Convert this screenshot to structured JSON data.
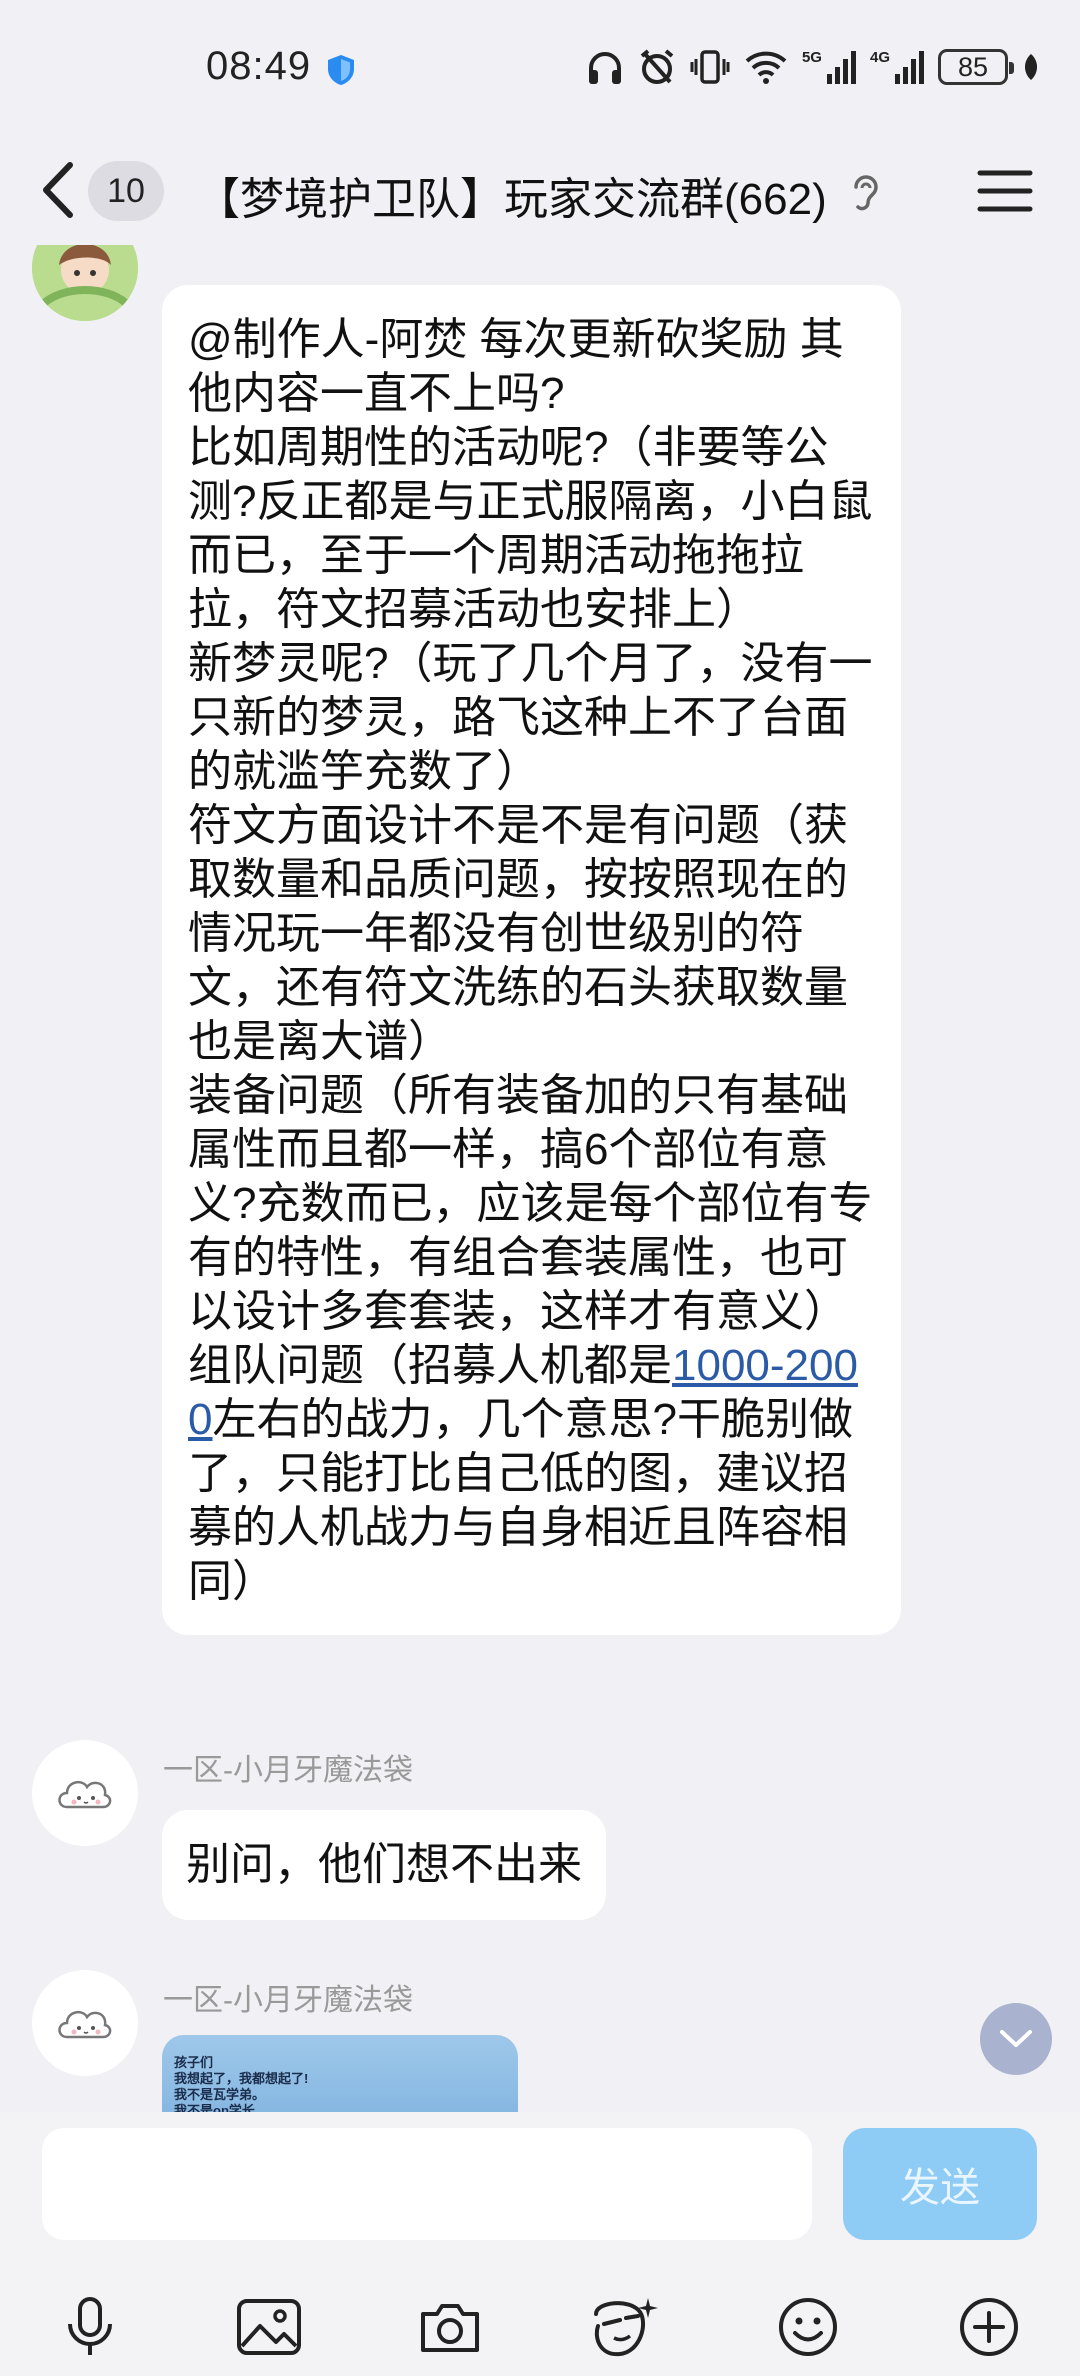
{
  "status_bar": {
    "time": "08:49",
    "net1": "5G",
    "net2": "4G",
    "battery": "85"
  },
  "header": {
    "unread_count": "10",
    "title": "【梦境护卫队】玩家交流群(662)"
  },
  "messages": [
    {
      "type": "text",
      "lines": [
        "@制作人-阿焚 每次更新砍奖励 其他内容一直不上吗?",
        "比如周期性的活动呢?（非要等公测?反正都是与正式服隔离，小白鼠而已，至于一个周期活动拖拖拉拉，符文招募活动也安排上）",
        "新梦灵呢?（玩了几个月了，没有一只新的梦灵，路飞这种上不了台面的就滥竽充数了）",
        "符文方面设计不是不是有问题（获取数量和品质问题，按按照现在的情况玩一年都没有创世级别的符文，还有符文洗练的石头获取数量也是离大谱）",
        "装备问题（所有装备加的只有基础属性而且都一样，搞6个部位有意义?充数而已，应该是每个部位有专有的特性，有组合套装属性，也可以设计多套套装，这样才有意义）"
      ],
      "last_line_pre": "组队问题（招募人机都是",
      "last_line_link": "1000-2000",
      "last_line_post": "左右的战力，几个意思?干脆别做了，只能打比自己低的图，建议招募的人机战力与自身相近且阵容相同）"
    },
    {
      "type": "text",
      "sender": "一区-小月牙魔法袋",
      "text": "别问，他们想不出来"
    },
    {
      "type": "image",
      "sender": "一区-小月牙魔法袋",
      "image_text": [
        "孩子们",
        "我想起了，我都想起了!",
        "我不是瓦学弟。",
        "我不是op学长"
      ]
    }
  ],
  "composer": {
    "input_value": "",
    "send_label": "发送"
  },
  "toolbar_icons": [
    "microphone-icon",
    "image-icon",
    "camera-icon",
    "sticker-creator-icon",
    "emoji-icon",
    "plus-icon"
  ]
}
